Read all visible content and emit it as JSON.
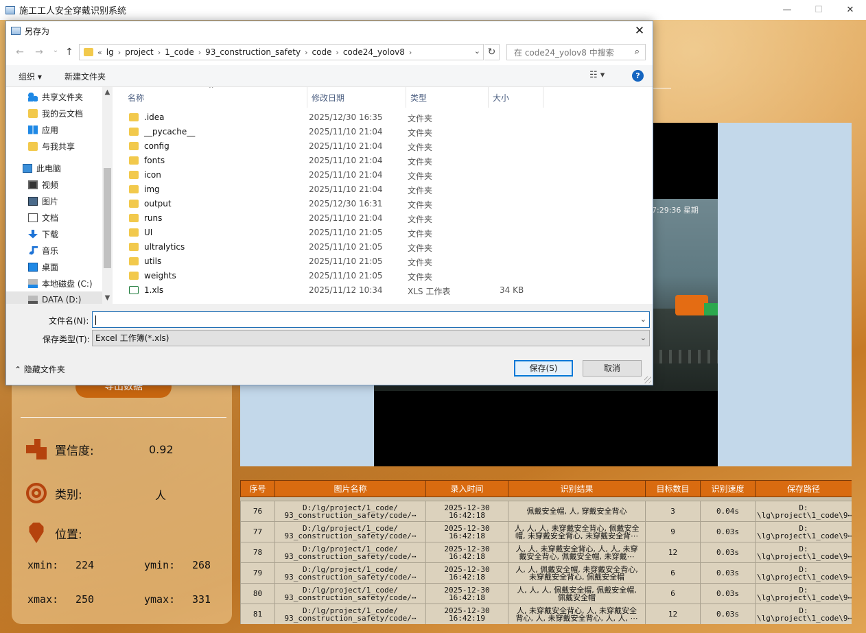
{
  "app": {
    "title": "施工工人安全穿戴识别系统",
    "minimize": "—",
    "maximize": "☐",
    "close": "✕",
    "export_label": "导出数据",
    "confidence_label": "置信度:",
    "confidence_value": "0.92",
    "category_label": "类别:",
    "category_value": "人",
    "position_label": "位置:",
    "xmin_label": "xmin:",
    "xmin_value": "224",
    "ymin_label": "ymin:",
    "ymin_value": "268",
    "xmax_label": "xmax:",
    "xmax_value": "250",
    "ymax_label": "ymax:",
    "ymax_value": "331",
    "video_timestamp": "7:29:36 星期",
    "table": {
      "headers": [
        "序号",
        "图片名称",
        "录入时间",
        "识别结果",
        "目标数目",
        "识别速度",
        "保存路径"
      ],
      "rows": [
        {
          "id": "76",
          "name": "D:/lg/project/1_code/\n93_construction_safety/code/⋯",
          "time": "2025-12-30\n16:42:18",
          "result": "佩戴安全帽, 人, 穿戴安全背心",
          "count": "3",
          "speed": "0.04s",
          "path": "D:\n\\lg\\project\\1_code\\9⋯"
        },
        {
          "id": "77",
          "name": "D:/lg/project/1_code/\n93_construction_safety/code/⋯",
          "time": "2025-12-30\n16:42:18",
          "result": "人, 人, 人, 未穿戴安全背心, 佩戴安全\n帽, 未穿戴安全背心, 未穿戴安全背⋯",
          "count": "9",
          "speed": "0.03s",
          "path": "D:\n\\lg\\project\\1_code\\9⋯"
        },
        {
          "id": "78",
          "name": "D:/lg/project/1_code/\n93_construction_safety/code/⋯",
          "time": "2025-12-30\n16:42:18",
          "result": "人, 人, 未穿戴安全背心, 人, 人, 未穿\n戴安全背心, 佩戴安全帽, 未穿戴⋯",
          "count": "12",
          "speed": "0.03s",
          "path": "D:\n\\lg\\project\\1_code\\9⋯"
        },
        {
          "id": "79",
          "name": "D:/lg/project/1_code/\n93_construction_safety/code/⋯",
          "time": "2025-12-30\n16:42:18",
          "result": "人, 人, 佩戴安全帽, 未穿戴安全背心,\n未穿戴安全背心, 佩戴安全帽",
          "count": "6",
          "speed": "0.03s",
          "path": "D:\n\\lg\\project\\1_code\\9⋯"
        },
        {
          "id": "80",
          "name": "D:/lg/project/1_code/\n93_construction_safety/code/⋯",
          "time": "2025-12-30\n16:42:18",
          "result": "人, 人, 人, 佩戴安全帽, 佩戴安全帽,\n佩戴安全帽",
          "count": "6",
          "speed": "0.03s",
          "path": "D:\n\\lg\\project\\1_code\\9⋯"
        },
        {
          "id": "81",
          "name": "D:/lg/project/1_code/\n93_construction_safety/code/⋯",
          "time": "2025-12-30\n16:42:19",
          "result": "人, 未穿戴安全背心, 人, 未穿戴安全\n背心, 人, 未穿戴安全背心, 人, 人, ⋯",
          "count": "12",
          "speed": "0.03s",
          "path": "D:\n\\lg\\project\\1_code\\9⋯"
        }
      ]
    }
  },
  "dialog": {
    "title": "另存为",
    "close": "✕",
    "nav": {
      "back": "←",
      "forward": "→",
      "history": "⌄",
      "up": "↑"
    },
    "address": {
      "prefix": "«",
      "segments": [
        "lg",
        "project",
        "1_code",
        "93_construction_safety",
        "code",
        "code24_yolov8"
      ],
      "sep": "›",
      "dropdown": "⌄",
      "refresh": "↻"
    },
    "search_placeholder": "在 code24_yolov8 中搜索",
    "search_icon": "⌕",
    "toolbar": {
      "organize": "组织 ▾",
      "new_folder": "新建文件夹",
      "view": "☷ ▾",
      "help": "?"
    },
    "nav_pane": [
      {
        "label": "共享文件夹",
        "icon": "ic-share",
        "name": "shared-folder-icon"
      },
      {
        "label": "我的云文档",
        "icon": "ic-folder",
        "name": "cloud-folder-icon"
      },
      {
        "label": "应用",
        "icon": "ic-apps",
        "name": "apps-icon"
      },
      {
        "label": "与我共享",
        "icon": "ic-folder",
        "name": "shared-with-me-icon"
      },
      {
        "label": "此电脑",
        "icon": "ic-pc",
        "name": "this-pc-icon"
      },
      {
        "label": "视频",
        "icon": "ic-video",
        "name": "video-icon"
      },
      {
        "label": "图片",
        "icon": "ic-pic",
        "name": "pictures-icon"
      },
      {
        "label": "文档",
        "icon": "ic-doc",
        "name": "documents-icon"
      },
      {
        "label": "下载",
        "icon": "ic-dl",
        "name": "download-icon"
      },
      {
        "label": "音乐",
        "icon": "ic-music",
        "name": "music-icon"
      },
      {
        "label": "桌面",
        "icon": "ic-desk",
        "name": "desktop-icon"
      },
      {
        "label": "本地磁盘 (C:)",
        "icon": "ic-disk",
        "name": "disk-c-icon"
      },
      {
        "label": "DATA (D:)",
        "icon": "ic-disk2",
        "name": "disk-d-icon"
      }
    ],
    "columns": [
      "名称",
      "修改日期",
      "类型",
      "大小"
    ],
    "sort_caret": "^",
    "files": [
      {
        "name": ".idea",
        "date": "2025/12/30 16:35",
        "type": "文件夹",
        "size": "",
        "kind": "folder"
      },
      {
        "name": "__pycache__",
        "date": "2025/11/10 21:04",
        "type": "文件夹",
        "size": "",
        "kind": "folder"
      },
      {
        "name": "config",
        "date": "2025/11/10 21:04",
        "type": "文件夹",
        "size": "",
        "kind": "folder"
      },
      {
        "name": "fonts",
        "date": "2025/11/10 21:04",
        "type": "文件夹",
        "size": "",
        "kind": "folder"
      },
      {
        "name": "icon",
        "date": "2025/11/10 21:04",
        "type": "文件夹",
        "size": "",
        "kind": "folder"
      },
      {
        "name": "img",
        "date": "2025/11/10 21:04",
        "type": "文件夹",
        "size": "",
        "kind": "folder"
      },
      {
        "name": "output",
        "date": "2025/12/30 16:31",
        "type": "文件夹",
        "size": "",
        "kind": "folder"
      },
      {
        "name": "runs",
        "date": "2025/11/10 21:04",
        "type": "文件夹",
        "size": "",
        "kind": "folder"
      },
      {
        "name": "UI",
        "date": "2025/11/10 21:05",
        "type": "文件夹",
        "size": "",
        "kind": "folder"
      },
      {
        "name": "ultralytics",
        "date": "2025/11/10 21:05",
        "type": "文件夹",
        "size": "",
        "kind": "folder"
      },
      {
        "name": "utils",
        "date": "2025/11/10 21:05",
        "type": "文件夹",
        "size": "",
        "kind": "folder"
      },
      {
        "name": "weights",
        "date": "2025/11/10 21:05",
        "type": "文件夹",
        "size": "",
        "kind": "folder"
      },
      {
        "name": "1.xls",
        "date": "2025/11/12 10:34",
        "type": "XLS 工作表",
        "size": "34 KB",
        "kind": "xls"
      }
    ],
    "filename_label": "文件名(N):",
    "filename_value": "",
    "filetype_label": "保存类型(T):",
    "filetype_value": "Excel 工作簿(*.xls)",
    "dropdown": "⌄",
    "hide_folders": "⌃ 隐藏文件夹",
    "save": "保存(S)",
    "cancel": "取消"
  }
}
